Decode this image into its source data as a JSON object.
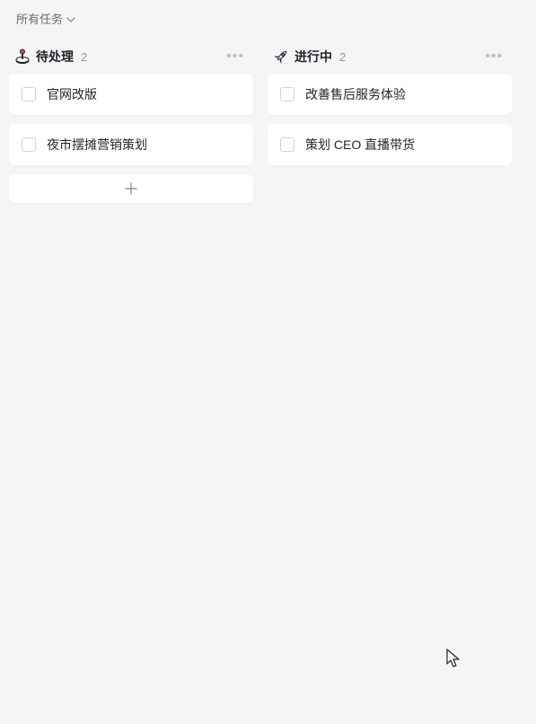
{
  "filter": {
    "label": "所有任务"
  },
  "columns": [
    {
      "icon": "joystick-icon",
      "title": "待处理",
      "count": 2,
      "cards": [
        {
          "title": "官网改版"
        },
        {
          "title": "夜市摆摊营销策划"
        }
      ],
      "showAdd": true
    },
    {
      "icon": "rocket-icon",
      "title": "进行中",
      "count": 2,
      "cards": [
        {
          "title": "改善售后服务体验"
        },
        {
          "title": "策划 CEO 直播带货"
        }
      ],
      "showAdd": false
    }
  ]
}
